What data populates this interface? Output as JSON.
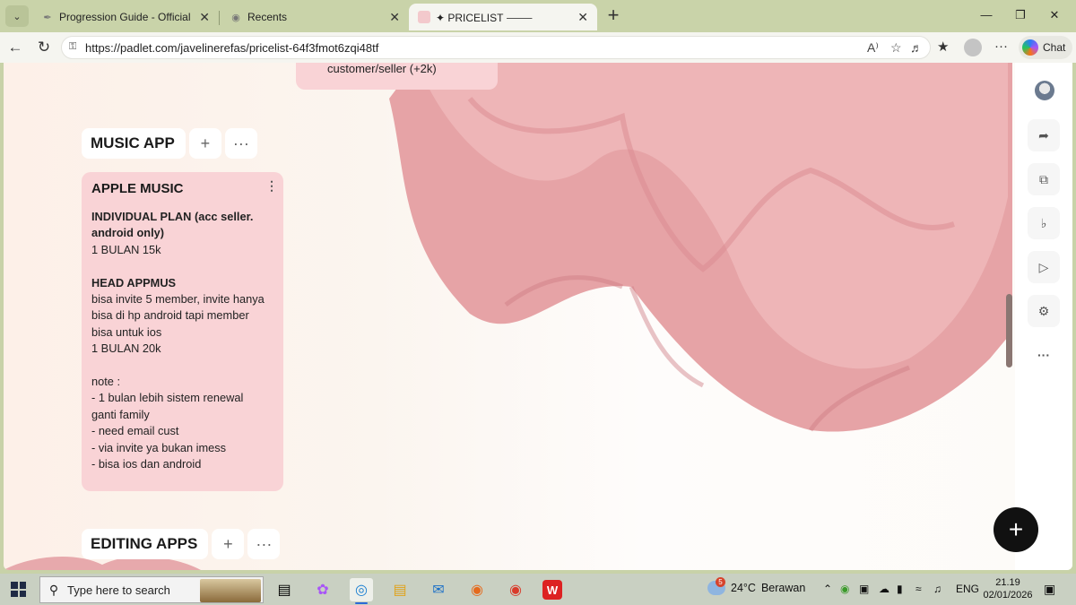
{
  "browser": {
    "tabs": [
      {
        "title": "Progression Guide - Official Fisch W",
        "active": false
      },
      {
        "title": "Recents",
        "active": false
      },
      {
        "title": "✦ PRICELIST ⸻ ",
        "active": true
      }
    ],
    "url": "https://padlet.com/javelinerefas/pricelist-64f3fmot6zqi48tf",
    "chat_label": "Chat"
  },
  "padlet": {
    "top_card_text": "customer/seller (+2k)",
    "sections": [
      {
        "title": "MUSIC APP",
        "add_symbol": "+",
        "more_symbol": "···"
      },
      {
        "title": "EDITING APPS",
        "add_symbol": "+",
        "more_symbol": "···"
      }
    ],
    "post": {
      "title": "APPLE MUSIC",
      "lines": {
        "l1": "INDIVIDUAL PLAN (acc seller.",
        "l2": "android only)",
        "l3": "1 BULAN 15k",
        "l4": "HEAD APPMUS",
        "l5": "bisa invite 5 member, invite hanya",
        "l6": "bisa di hp android tapi member",
        "l7": "bisa untuk ios",
        "l8": "1 BULAN 20k",
        "l9": "note :",
        "l10": "- 1 bulan lebih sistem renewal",
        "l11": "ganti family",
        "l12": "- need email cust",
        "l13": "- via invite ya bukan imess",
        "l14": "- bisa ios dan android"
      }
    },
    "fab_symbol": "+",
    "accent_post_color": "#f9d3d6"
  },
  "taskbar": {
    "search_placeholder": "Type here to search",
    "weather_temp": "24°C",
    "weather_desc": "Berawan",
    "weather_badge": "5",
    "language": "ENG",
    "time": "21.19",
    "date": "02/01/2026"
  }
}
